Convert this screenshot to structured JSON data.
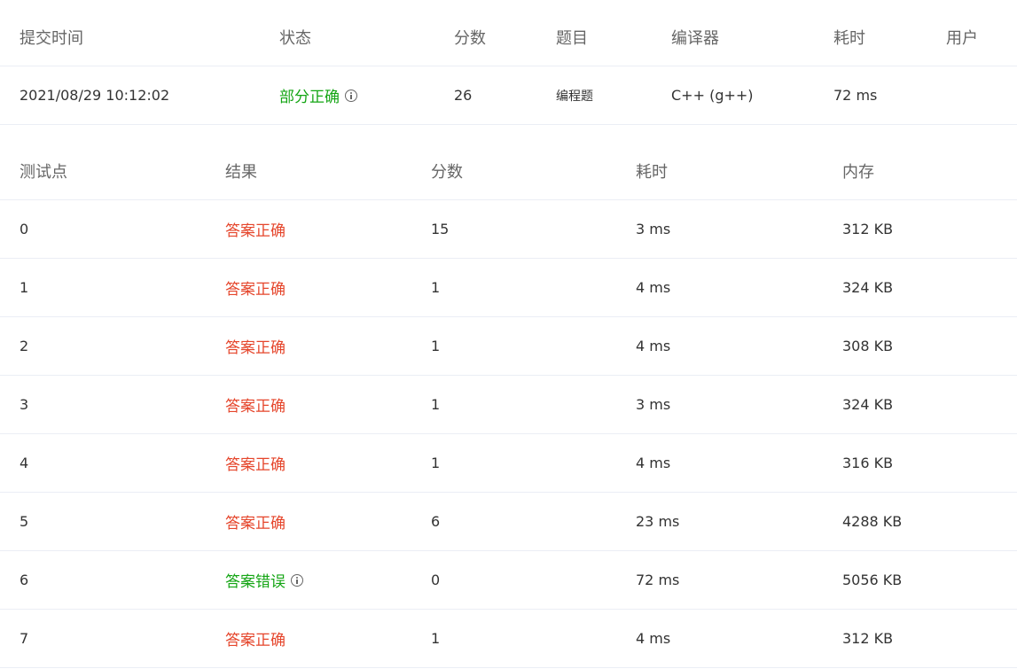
{
  "submission": {
    "headers": {
      "time": "提交时间",
      "status": "状态",
      "score": "分数",
      "problem": "题目",
      "compiler": "编译器",
      "duration": "耗时",
      "user": "用户"
    },
    "row": {
      "time": "2021/08/29 10:12:02",
      "status": "部分正确",
      "score": "26",
      "problem": "编程题",
      "compiler": "C++ (g++)",
      "duration": "72 ms",
      "user": ""
    }
  },
  "testcases": {
    "headers": {
      "case": "测试点",
      "result": "结果",
      "score": "分数",
      "duration": "耗时",
      "memory": "内存"
    },
    "rows": [
      {
        "case": "0",
        "result": "答案正确",
        "score": "15",
        "duration": "3 ms",
        "memory": "312 KB",
        "status": "ok"
      },
      {
        "case": "1",
        "result": "答案正确",
        "score": "1",
        "duration": "4 ms",
        "memory": "324 KB",
        "status": "ok"
      },
      {
        "case": "2",
        "result": "答案正确",
        "score": "1",
        "duration": "4 ms",
        "memory": "308 KB",
        "status": "ok"
      },
      {
        "case": "3",
        "result": "答案正确",
        "score": "1",
        "duration": "3 ms",
        "memory": "324 KB",
        "status": "ok"
      },
      {
        "case": "4",
        "result": "答案正确",
        "score": "1",
        "duration": "4 ms",
        "memory": "316 KB",
        "status": "ok"
      },
      {
        "case": "5",
        "result": "答案正确",
        "score": "6",
        "duration": "23 ms",
        "memory": "4288 KB",
        "status": "ok"
      },
      {
        "case": "6",
        "result": "答案错误",
        "score": "0",
        "duration": "72 ms",
        "memory": "5056 KB",
        "status": "wrong"
      },
      {
        "case": "7",
        "result": "答案正确",
        "score": "1",
        "duration": "4 ms",
        "memory": "312 KB",
        "status": "ok"
      }
    ]
  },
  "colors": {
    "accepted_text": "#e5452b",
    "partial_or_wrong_text": "#14a514",
    "divider": "#ebeef5"
  },
  "icons": {
    "status_info": "info-circle-icon"
  }
}
